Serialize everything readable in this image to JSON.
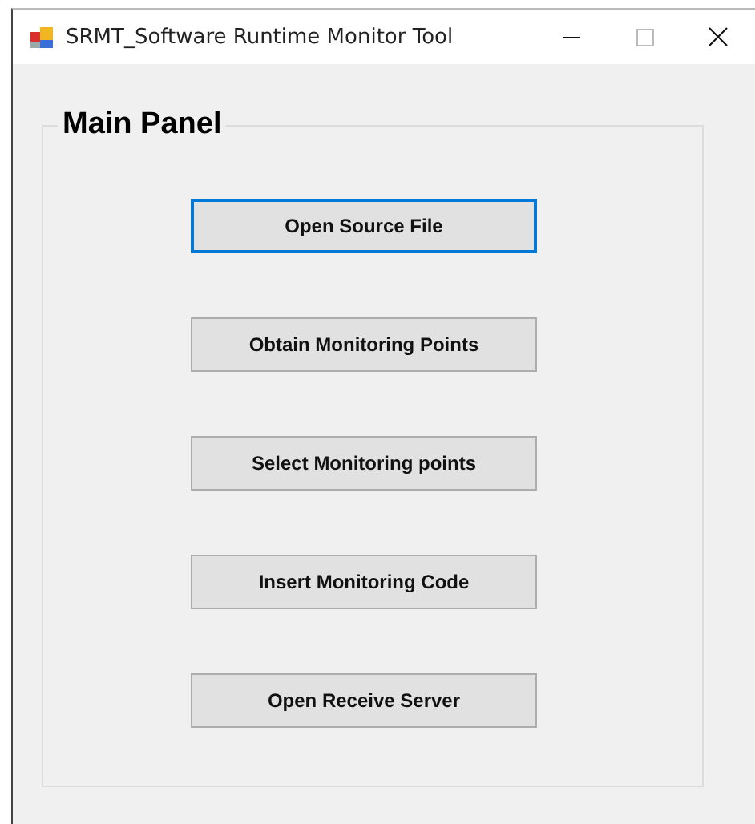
{
  "window": {
    "title": "SRMT_Software Runtime Monitor Tool"
  },
  "main_panel": {
    "title": "Main Panel",
    "buttons": [
      {
        "label": "Open Source File",
        "focused": true
      },
      {
        "label": "Obtain Monitoring Points",
        "focused": false
      },
      {
        "label": "Select Monitoring points",
        "focused": false
      },
      {
        "label": "Insert Monitoring Code",
        "focused": false
      },
      {
        "label": "Open Receive Server",
        "focused": false
      }
    ]
  }
}
